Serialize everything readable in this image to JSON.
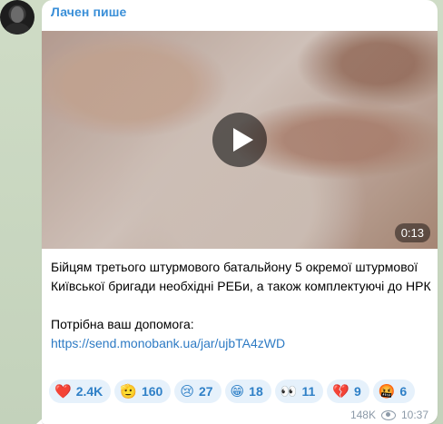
{
  "channel": {
    "author_name": "Лачен пише"
  },
  "video": {
    "duration": "0:13",
    "play_icon": "play-icon"
  },
  "message": {
    "line1": "Бійцям третього штурмового батальйону 5 окремої штурмової Київської бригади необхідні РЕБи, а також комплектуючі до НРК",
    "line2": "Потрібна ваш допомога:",
    "link": "https://send.monobank.ua/jar/ujbTA4zWD"
  },
  "reactions": [
    {
      "emoji": "❤️",
      "count": "2.4K",
      "icon": "heart-icon"
    },
    {
      "emoji": "🫡",
      "count": "160",
      "icon": "salute-icon"
    },
    {
      "emoji": "😢",
      "count": "27",
      "icon": "crying-face-icon"
    },
    {
      "emoji": "😁",
      "count": "18",
      "icon": "grinning-face-icon"
    },
    {
      "emoji": "👀",
      "count": "11",
      "icon": "eyes-icon"
    },
    {
      "emoji": "💔",
      "count": "9",
      "icon": "broken-heart-icon"
    },
    {
      "emoji": "🤬",
      "count": "6",
      "icon": "angry-face-icon"
    }
  ],
  "meta": {
    "views": "148K",
    "time": "10:37",
    "views_icon": "eye-icon"
  },
  "colors": {
    "accent": "#3a8fd8",
    "link": "#2e7bc4",
    "reaction_bg": "#e6f1fb"
  }
}
